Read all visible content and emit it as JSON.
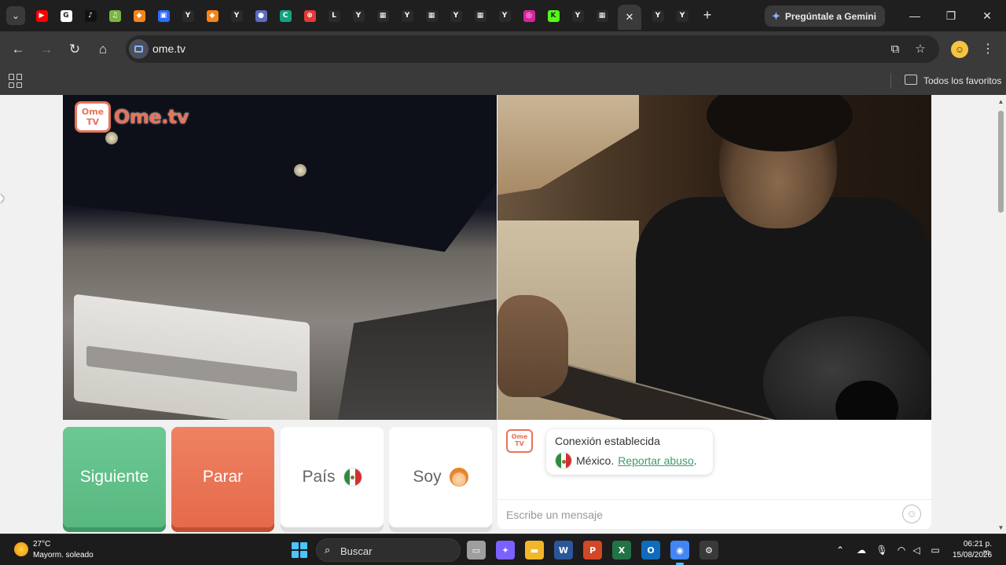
{
  "browser": {
    "tabs": [
      {
        "icon": "youtube-icon",
        "color": "#ff0000",
        "glyph": "▶"
      },
      {
        "icon": "google-icon",
        "color": "#ffffff",
        "glyph": "G"
      },
      {
        "icon": "tiktok-icon",
        "color": "#111111",
        "glyph": "♪"
      },
      {
        "icon": "music-icon",
        "color": "#7cb342",
        "glyph": "♫"
      },
      {
        "icon": "brave-icon",
        "color": "#f6851b",
        "glyph": "◆"
      },
      {
        "icon": "roblox-icon",
        "color": "#2b6cff",
        "glyph": "▣"
      },
      {
        "icon": "y-icon",
        "color": "#2a2a2a",
        "glyph": "Y"
      },
      {
        "icon": "brave-icon",
        "color": "#f6851b",
        "glyph": "◆"
      },
      {
        "icon": "y-icon",
        "color": "#2a2a2a",
        "glyph": "Y"
      },
      {
        "icon": "drop-icon",
        "color": "#5c6bc0",
        "glyph": "●"
      },
      {
        "icon": "c-icon",
        "color": "#14a37f",
        "glyph": "C"
      },
      {
        "icon": "block-icon",
        "color": "#e53935",
        "glyph": "⊗"
      },
      {
        "icon": "lc-icon",
        "color": "#2a2a2a",
        "glyph": "L"
      },
      {
        "icon": "y-icon",
        "color": "#2a2a2a",
        "glyph": "Y"
      },
      {
        "icon": "grid-icon",
        "color": "#2a2a2a",
        "glyph": "▦"
      },
      {
        "icon": "y-icon",
        "color": "#2a2a2a",
        "glyph": "Y"
      },
      {
        "icon": "grid-icon",
        "color": "#2a2a2a",
        "glyph": "▦"
      },
      {
        "icon": "y-icon",
        "color": "#2a2a2a",
        "glyph": "Y"
      },
      {
        "icon": "grid-icon",
        "color": "#2a2a2a",
        "glyph": "▦"
      },
      {
        "icon": "y-icon",
        "color": "#2a2a2a",
        "glyph": "Y"
      },
      {
        "icon": "instagram-icon",
        "color": "#d6249f",
        "glyph": "◎"
      },
      {
        "icon": "kick-icon",
        "color": "#53fc18",
        "glyph": "K"
      },
      {
        "icon": "y-icon",
        "color": "#2a2a2a",
        "glyph": "Y"
      },
      {
        "icon": "grid-icon",
        "color": "#2a2a2a",
        "glyph": "▦"
      },
      {
        "icon": "grid-icon",
        "color": "#2a2a2a",
        "glyph": "▦"
      }
    ],
    "trailing_tabs": [
      {
        "icon": "y-icon",
        "color": "#2a2a2a",
        "glyph": "Y"
      },
      {
        "icon": "y-icon",
        "color": "#2a2a2a",
        "glyph": "Y"
      }
    ],
    "gemini_label": "Pregúntale a Gemini",
    "url": "ome.tv",
    "bookmarks_all_label": "Todos los favoritos"
  },
  "page": {
    "logo_word": "Ome.tv",
    "logo_icon_top": "Ome",
    "logo_icon_bottom": "TV",
    "buttons": {
      "next": "Siguiente",
      "stop": "Parar",
      "country": "País",
      "gender": "Soy"
    },
    "chat": {
      "status": "Conexión establecida",
      "country": "México.",
      "report_link": "Reportar abuso",
      "report_suffix": ".",
      "input_placeholder": "Escribe un mensaje"
    }
  },
  "taskbar": {
    "weather_temp": "27°C",
    "weather_desc": "Mayorm. soleado",
    "search_label": "Buscar",
    "apps": [
      {
        "icon": "task-view-icon",
        "color": "#9e9e9e",
        "glyph": "▭"
      },
      {
        "icon": "copilot-icon",
        "color": "#7b61ff",
        "glyph": "✦"
      },
      {
        "icon": "file-explorer-icon",
        "color": "#f3b52a",
        "glyph": "▬"
      },
      {
        "icon": "word-icon",
        "color": "#2b579a",
        "glyph": "W"
      },
      {
        "icon": "powerpoint-icon",
        "color": "#d24726",
        "glyph": "P"
      },
      {
        "icon": "excel-icon",
        "color": "#217346",
        "glyph": "X"
      },
      {
        "icon": "outlook-icon",
        "color": "#0f6cbd",
        "glyph": "O"
      },
      {
        "icon": "chrome-icon",
        "color": "#4285f4",
        "glyph": "◉"
      },
      {
        "icon": "settings-icon",
        "color": "#3a3a3a",
        "glyph": "⚙"
      }
    ],
    "time": "06:21 p. m.",
    "date": "15/08/2026"
  }
}
